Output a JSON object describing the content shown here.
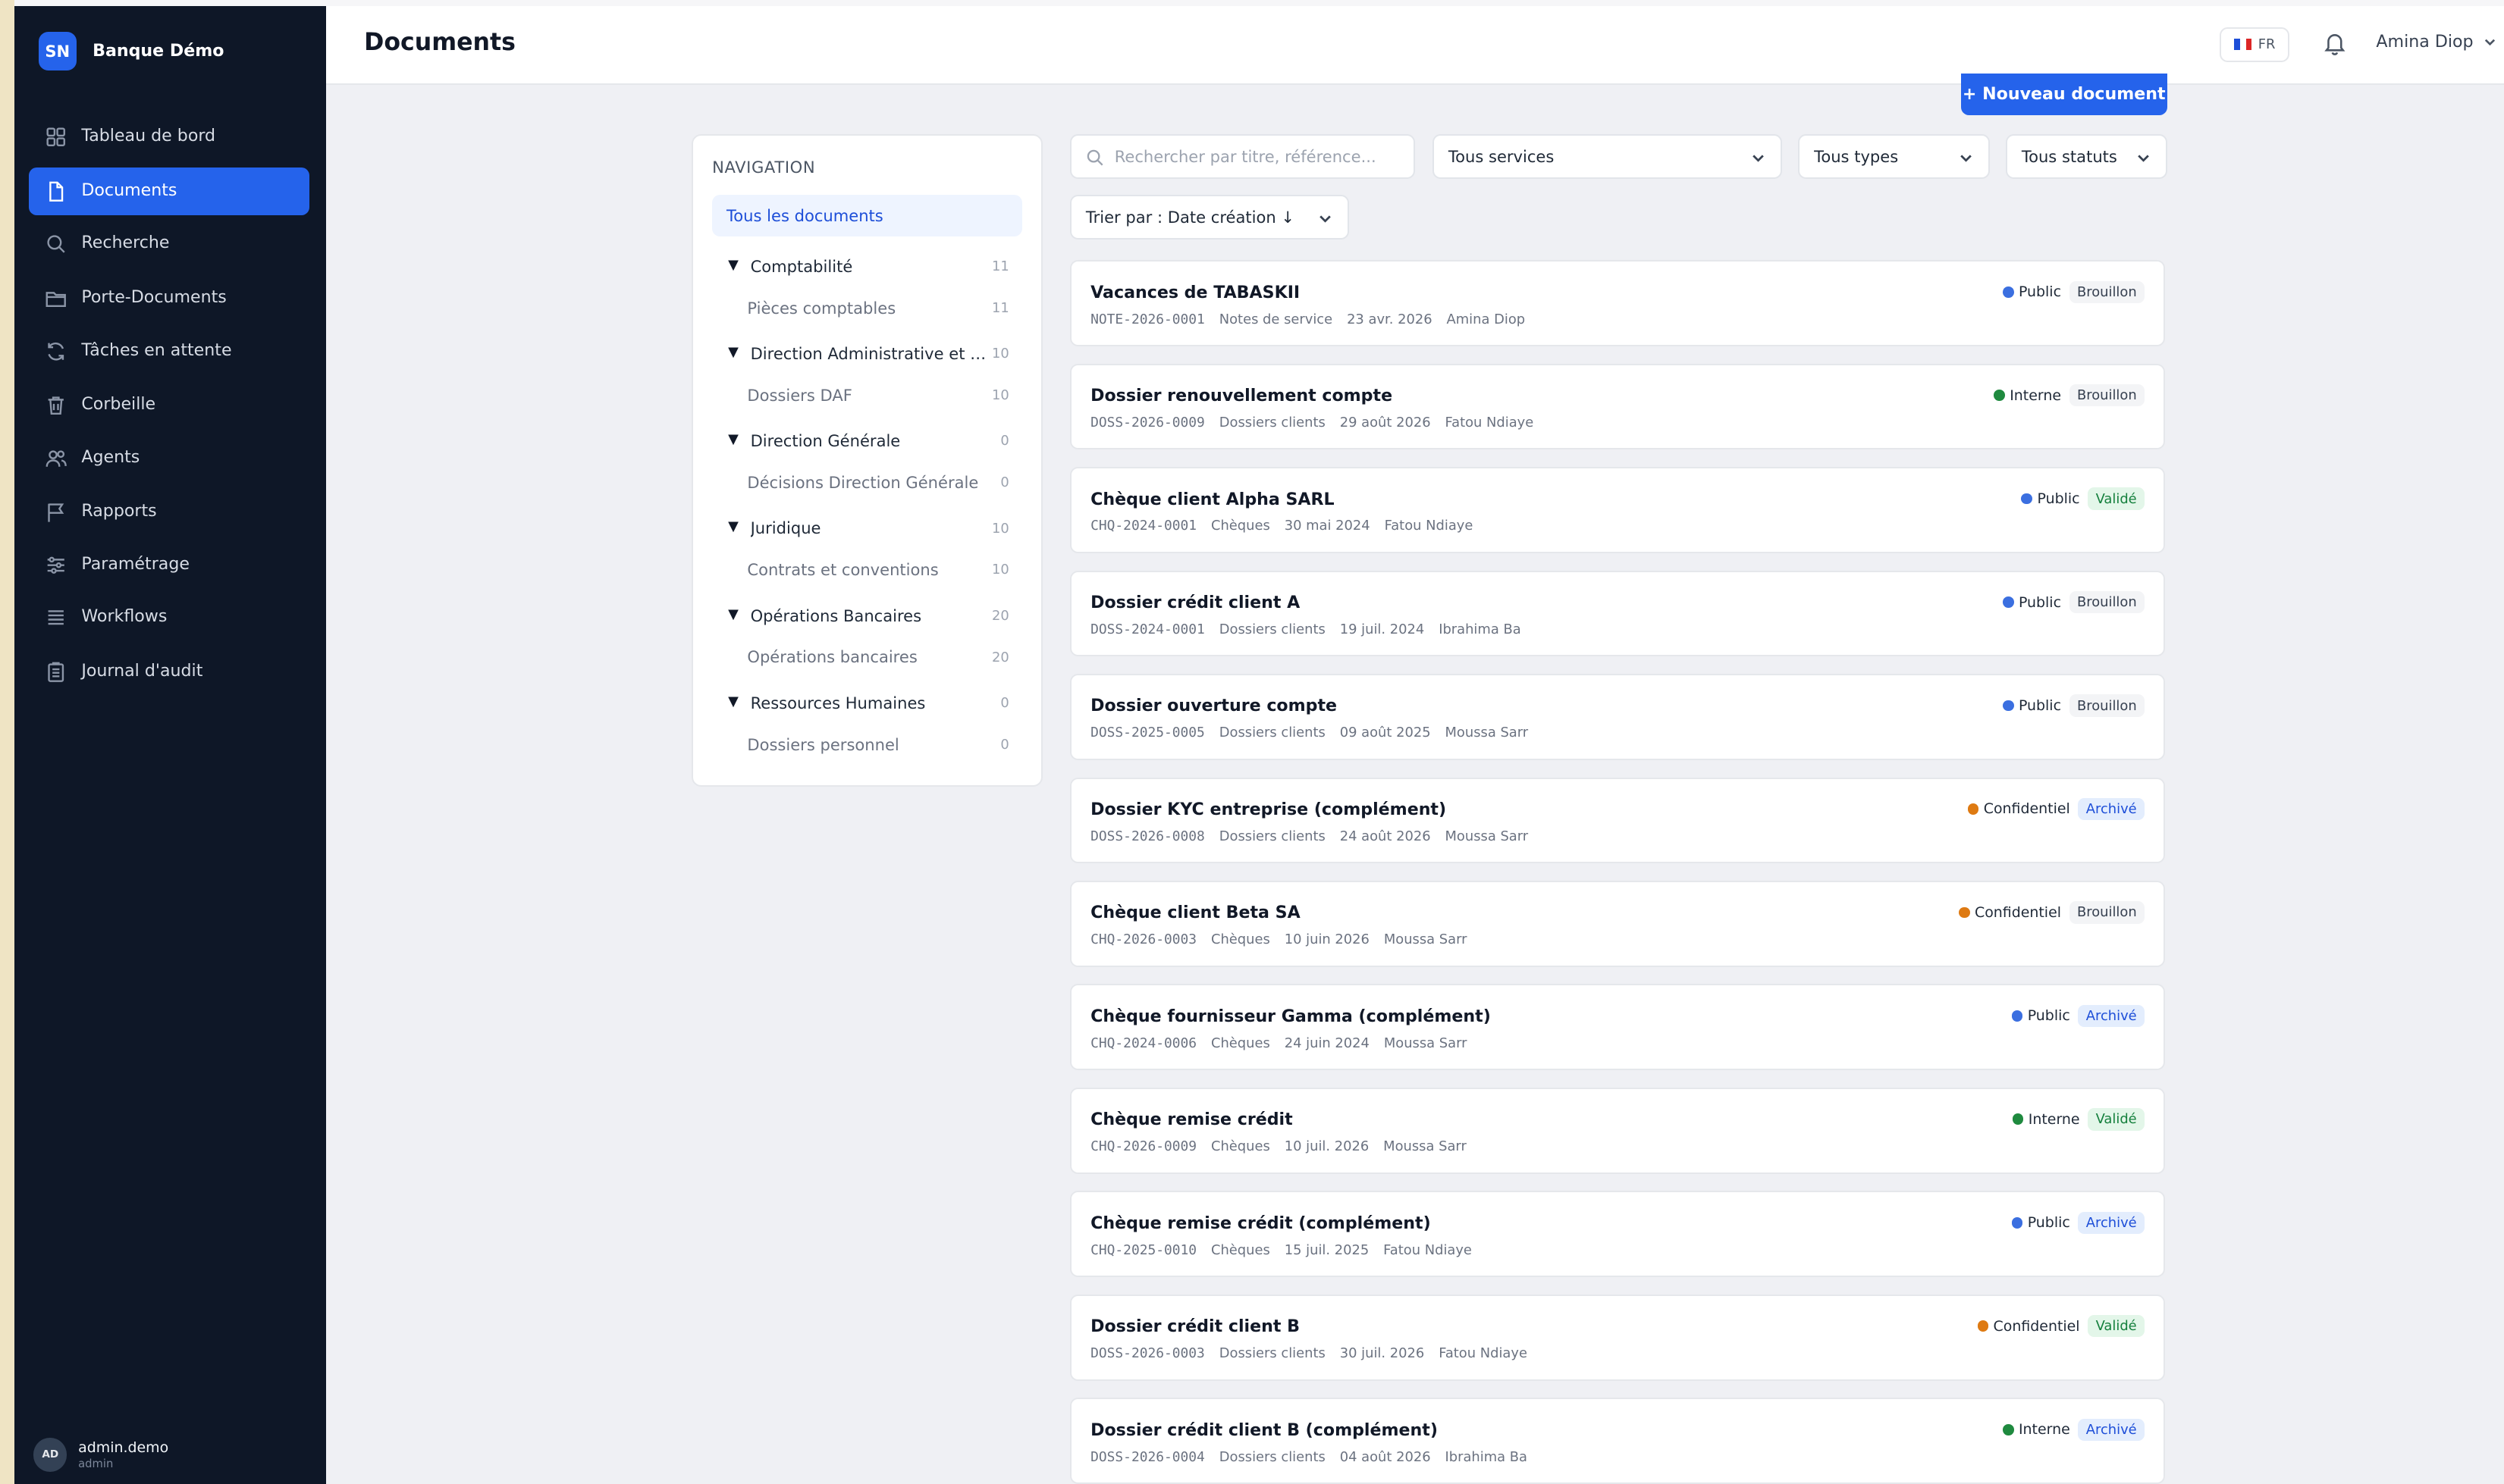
{
  "app": {
    "logo": "SN",
    "brand": "Banque Démo"
  },
  "sidebar": {
    "items": [
      {
        "label": "Tableau de bord",
        "icon": "grid-icon"
      },
      {
        "label": "Documents",
        "icon": "file-icon",
        "active": true
      },
      {
        "label": "Recherche",
        "icon": "search-icon"
      },
      {
        "label": "Porte-Documents",
        "icon": "folder-icon"
      },
      {
        "label": "Tâches en attente",
        "icon": "refresh-icon"
      },
      {
        "label": "Corbeille",
        "icon": "trash-icon"
      },
      {
        "label": "Agents",
        "icon": "users-icon"
      },
      {
        "label": "Rapports",
        "icon": "flag-icon"
      },
      {
        "label": "Paramétrage",
        "icon": "sliders-icon"
      },
      {
        "label": "Workflows",
        "icon": "list-icon"
      },
      {
        "label": "Journal d'audit",
        "icon": "clipboard-icon"
      }
    ],
    "user": {
      "initials": "AD",
      "name": "admin.demo",
      "role": "admin"
    }
  },
  "header": {
    "title": "Documents",
    "lang": "FR",
    "user": "Amina Diop"
  },
  "actions": {
    "new_document": "+ Nouveau document"
  },
  "navigation": {
    "heading": "NAVIGATION",
    "all": "Tous les documents",
    "groups": [
      {
        "name": "Comptabilité",
        "count": "11",
        "sub": "Pièces comptables",
        "sub_count": "11"
      },
      {
        "name": "Direction Administrative et Financière",
        "count": "10",
        "sub": "Dossiers DAF",
        "sub_count": "10"
      },
      {
        "name": "Direction Générale",
        "count": "0",
        "sub": "Décisions Direction Générale",
        "sub_count": "0"
      },
      {
        "name": "Juridique",
        "count": "10",
        "sub": "Contrats et conventions",
        "sub_count": "10"
      },
      {
        "name": "Opérations Bancaires",
        "count": "20",
        "sub": "Opérations bancaires",
        "sub_count": "20"
      },
      {
        "name": "Ressources Humaines",
        "count": "0",
        "sub": "Dossiers personnel",
        "sub_count": "0"
      }
    ]
  },
  "filters": {
    "search_placeholder": "Rechercher par titre, référence...",
    "services": "Tous services",
    "types": "Tous types",
    "statuses": "Tous statuts",
    "sort": "Trier par : Date création ↓"
  },
  "colors": {
    "accent": "#2563eb",
    "sidebar_bg": "#0e1727",
    "confidentiality": {
      "Public": "#3b6fe0",
      "Interne": "#1f8a3f",
      "Confidentiel": "#de7a12"
    }
  },
  "documents": [
    {
      "title": "Vacances de TABASKII",
      "ref": "NOTE-2026-0001",
      "type": "Notes de service",
      "date": "23 avr. 2026",
      "author": "Amina Diop",
      "confidentiality": "Public",
      "status": "Brouillon"
    },
    {
      "title": "Dossier renouvellement compte",
      "ref": "DOSS-2026-0009",
      "type": "Dossiers clients",
      "date": "29 août 2026",
      "author": "Fatou Ndiaye",
      "confidentiality": "Interne",
      "status": "Brouillon"
    },
    {
      "title": "Chèque client Alpha SARL",
      "ref": "CHQ-2024-0001",
      "type": "Chèques",
      "date": "30 mai 2024",
      "author": "Fatou Ndiaye",
      "confidentiality": "Public",
      "status": "Validé"
    },
    {
      "title": "Dossier crédit client A",
      "ref": "DOSS-2024-0001",
      "type": "Dossiers clients",
      "date": "19 juil. 2024",
      "author": "Ibrahima Ba",
      "confidentiality": "Public",
      "status": "Brouillon"
    },
    {
      "title": "Dossier ouverture compte",
      "ref": "DOSS-2025-0005",
      "type": "Dossiers clients",
      "date": "09 août 2025",
      "author": "Moussa Sarr",
      "confidentiality": "Public",
      "status": "Brouillon"
    },
    {
      "title": "Dossier KYC entreprise (complément)",
      "ref": "DOSS-2026-0008",
      "type": "Dossiers clients",
      "date": "24 août 2026",
      "author": "Moussa Sarr",
      "confidentiality": "Confidentiel",
      "status": "Archivé"
    },
    {
      "title": "Chèque client Beta SA",
      "ref": "CHQ-2026-0003",
      "type": "Chèques",
      "date": "10 juin 2026",
      "author": "Moussa Sarr",
      "confidentiality": "Confidentiel",
      "status": "Brouillon"
    },
    {
      "title": "Chèque fournisseur Gamma (complément)",
      "ref": "CHQ-2024-0006",
      "type": "Chèques",
      "date": "24 juin 2024",
      "author": "Moussa Sarr",
      "confidentiality": "Public",
      "status": "Archivé"
    },
    {
      "title": "Chèque remise crédit",
      "ref": "CHQ-2026-0009",
      "type": "Chèques",
      "date": "10 juil. 2026",
      "author": "Moussa Sarr",
      "confidentiality": "Interne",
      "status": "Validé"
    },
    {
      "title": "Chèque remise crédit (complément)",
      "ref": "CHQ-2025-0010",
      "type": "Chèques",
      "date": "15 juil. 2025",
      "author": "Fatou Ndiaye",
      "confidentiality": "Public",
      "status": "Archivé"
    },
    {
      "title": "Dossier crédit client B",
      "ref": "DOSS-2026-0003",
      "type": "Dossiers clients",
      "date": "30 juil. 2026",
      "author": "Fatou Ndiaye",
      "confidentiality": "Confidentiel",
      "status": "Validé"
    },
    {
      "title": "Dossier crédit client B (complément)",
      "ref": "DOSS-2026-0004",
      "type": "Dossiers clients",
      "date": "04 août 2026",
      "author": "Ibrahima Ba",
      "confidentiality": "Interne",
      "status": "Archivé"
    }
  ]
}
